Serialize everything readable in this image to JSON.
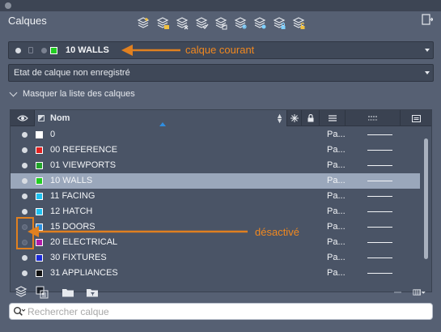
{
  "panel": {
    "title": "Calques",
    "toolbar_icons": [
      "new-layer-icon",
      "new-layer-vp-icon",
      "delete-layer-icon",
      "set-current-icon",
      "layer-iso-icon",
      "freeze-icon",
      "layer-off-icon",
      "layer-lock-icon",
      "layer-unlock-icon"
    ]
  },
  "current_layer": {
    "name": "10 WALLS",
    "color": "#22cc22"
  },
  "layer_state": {
    "value": "Etat de calque non enregistré"
  },
  "list_toggle": {
    "label": "Masquer la liste des calques"
  },
  "grid": {
    "columns": {
      "name": "Nom"
    },
    "layers": [
      {
        "name": "0",
        "color": "#ffffff",
        "on": true,
        "plot": "Pa...",
        "selected": false
      },
      {
        "name": "00 REFERENCE",
        "color": "#e02020",
        "on": true,
        "plot": "Pa...",
        "selected": false
      },
      {
        "name": "01 VIEWPORTS",
        "color": "#22a52a",
        "on": true,
        "plot": "Pa...",
        "selected": false
      },
      {
        "name": "10 WALLS",
        "color": "#22cc22",
        "on": true,
        "plot": "Pa...",
        "selected": true
      },
      {
        "name": "11 FACING",
        "color": "#1ec0f0",
        "on": true,
        "plot": "Pa...",
        "selected": false
      },
      {
        "name": "12 HATCH",
        "color": "#1ec0f0",
        "on": true,
        "plot": "Pa...",
        "selected": false
      },
      {
        "name": "15 DOORS",
        "color": "#2a8fe0",
        "on": false,
        "plot": "Pa...",
        "selected": false
      },
      {
        "name": "20 ELECTRICAL",
        "color": "#b01aa8",
        "on": false,
        "plot": "Pa...",
        "selected": false
      },
      {
        "name": "30 FIXTURES",
        "color": "#1a2ad8",
        "on": true,
        "plot": "Pa...",
        "selected": false
      },
      {
        "name": "31 APPLIANCES",
        "color": "#111111",
        "on": true,
        "plot": "Pa...",
        "selected": false
      }
    ]
  },
  "search": {
    "placeholder": "Rechercher calque"
  },
  "annotations": {
    "current": "calque courant",
    "off": "désactivé",
    "color": "#f08820"
  }
}
